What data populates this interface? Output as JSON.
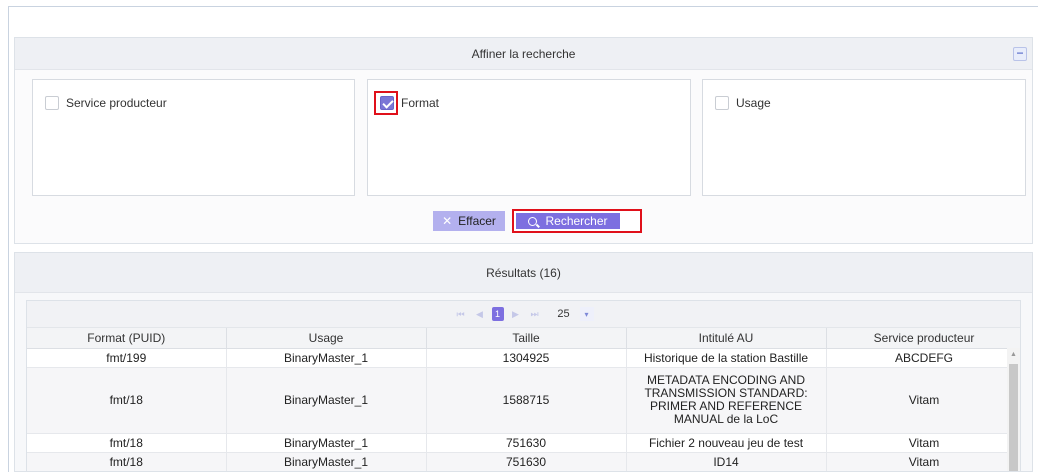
{
  "filter": {
    "title": "Affiner la recherche",
    "collapse_symbol": "−",
    "facets": [
      {
        "label": "Service producteur",
        "checked": false
      },
      {
        "label": "Format",
        "checked": true
      },
      {
        "label": "Usage",
        "checked": false
      }
    ],
    "clear_label": "Effacer",
    "search_label": "Rechercher"
  },
  "results": {
    "title": "Résultats (16)",
    "pager": {
      "first": "⏮",
      "prev": "◀",
      "current_page": "1",
      "next": "▶",
      "last": "⏭",
      "page_size": "25",
      "page_size_caret": "▾"
    },
    "columns": [
      "Format (PUID)",
      "Usage",
      "Taille",
      "Intitulé AU",
      "Service producteur"
    ],
    "rows": [
      {
        "format": "fmt/199",
        "usage": "BinaryMaster_1",
        "taille": "1304925",
        "intitule": "Historique de la station Bastille",
        "service": "ABCDEFG"
      },
      {
        "format": "fmt/18",
        "usage": "BinaryMaster_1",
        "taille": "1588715",
        "intitule": "METADATA ENCODING AND TRANSMISSION STANDARD: PRIMER AND REFERENCE MANUAL de la LoC",
        "service": "Vitam"
      },
      {
        "format": "fmt/18",
        "usage": "BinaryMaster_1",
        "taille": "751630",
        "intitule": "Fichier 2 nouveau jeu de test",
        "service": "Vitam"
      },
      {
        "format": "fmt/18",
        "usage": "BinaryMaster_1",
        "taille": "751630",
        "intitule": "ID14",
        "service": "Vitam"
      }
    ]
  },
  "colors": {
    "accent": "#7d6fe0",
    "highlight": "#e0101a",
    "header_bg": "#eef0f4"
  }
}
